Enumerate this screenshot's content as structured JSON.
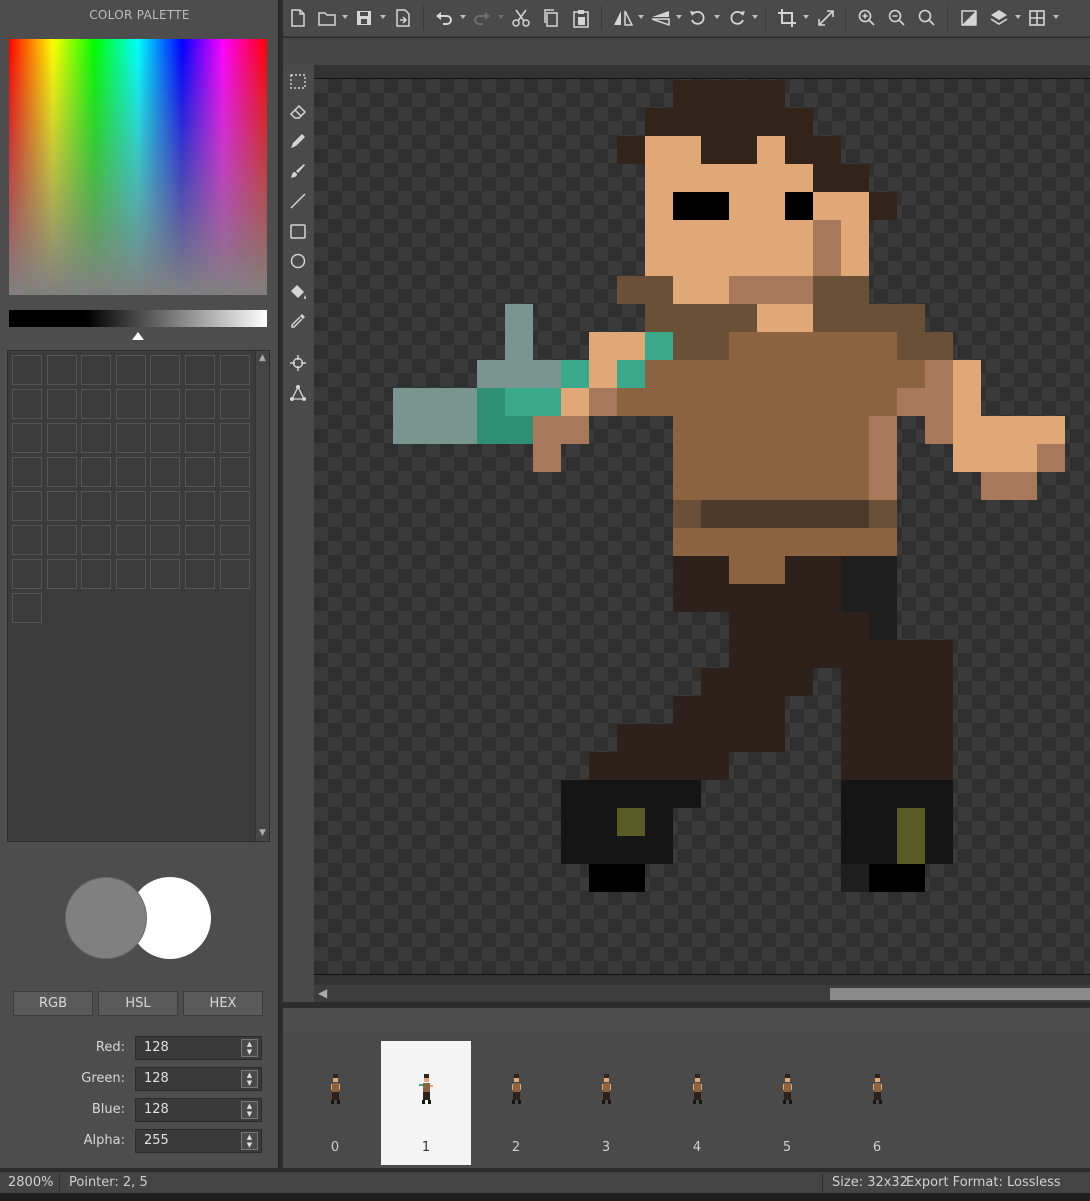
{
  "palette": {
    "title": "COLOR PALETTE",
    "mode_buttons": [
      "RGB",
      "HSL",
      "HEX"
    ],
    "fields": [
      {
        "label": "Red:",
        "value": "128"
      },
      {
        "label": "Green:",
        "value": "128"
      },
      {
        "label": "Blue:",
        "value": "128"
      },
      {
        "label": "Alpha:",
        "value": "255"
      }
    ],
    "primary_color": "#808080",
    "secondary_color": "#ffffff"
  },
  "toolbar": {
    "icons": [
      "new-file-icon",
      "open-folder-icon",
      "save-icon",
      "export-icon",
      "undo-icon",
      "redo-icon",
      "cut-icon",
      "copy-icon",
      "paste-icon",
      "flip-horizontal-icon",
      "flip-vertical-icon",
      "rotate-left-icon",
      "rotate-right-icon",
      "crop-icon",
      "resize-icon",
      "zoom-in-icon",
      "zoom-out-icon",
      "zoom-fit-icon",
      "mask-icon",
      "layers-icon",
      "grid-icon"
    ]
  },
  "tools": [
    "select-rect-icon",
    "eraser-icon",
    "pencil-icon",
    "brush-icon",
    "line-icon",
    "rectangle-icon",
    "ellipse-icon",
    "fill-bucket-icon",
    "eyedropper-icon",
    "crosshair-icon",
    "transform-icon"
  ],
  "timeline": {
    "frames": [
      "0",
      "1",
      "2",
      "3",
      "4",
      "5",
      "6"
    ],
    "selected_index": 1
  },
  "status": {
    "zoom": "2800%",
    "pointer": "Pointer: 2, 5",
    "size": "Size: 32x32",
    "export_format": "Export Format: Lossless"
  },
  "colors": {
    "hair": "#33241a",
    "skin": "#e0a877",
    "skin_shadow": "#a8785a",
    "shirt": "#8b6340",
    "shirt_dark": "#6b5038",
    "belt": "#4e3a2a",
    "pants": "#2c211b",
    "boots": "#151515",
    "teal": "#3aa88a",
    "gray_blue": "#7a9490",
    "buckle": "#5a5a24"
  }
}
